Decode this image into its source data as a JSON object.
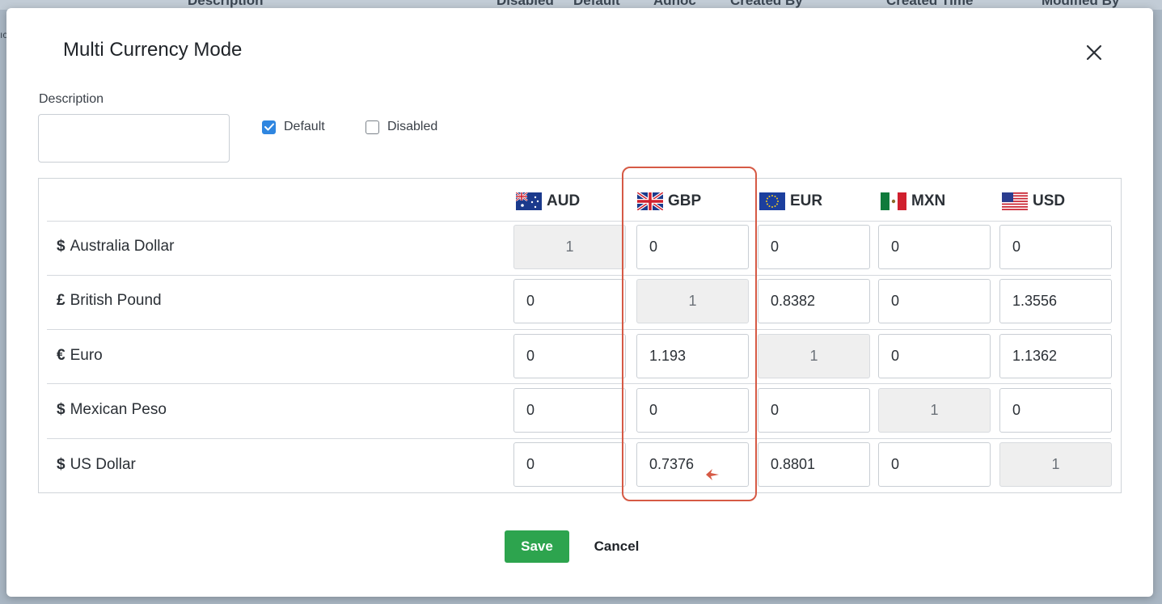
{
  "background_header": {
    "columns": [
      "Description",
      "Disabled",
      "Default",
      "Adhoc",
      "Created By",
      "Created Time",
      "Modified By"
    ],
    "edge_text": "ıc"
  },
  "modal": {
    "title": "Multi Currency Mode",
    "description_label": "Description",
    "description_value": "",
    "default_label": "Default",
    "default_checked": true,
    "disabled_label": "Disabled",
    "disabled_checked": false,
    "save_label": "Save",
    "cancel_label": "Cancel"
  },
  "currencies": [
    {
      "code": "AUD",
      "flag": "australia-flag-icon"
    },
    {
      "code": "GBP",
      "flag": "uk-flag-icon"
    },
    {
      "code": "EUR",
      "flag": "eu-flag-icon"
    },
    {
      "code": "MXN",
      "flag": "mexico-flag-icon"
    },
    {
      "code": "USD",
      "flag": "us-flag-icon"
    }
  ],
  "rows": [
    {
      "symbol": "$",
      "name": "Australia Dollar",
      "values": [
        "1",
        "0",
        "0",
        "0",
        "0"
      ]
    },
    {
      "symbol": "£",
      "name": "British Pound",
      "values": [
        "0",
        "1",
        "0.8382",
        "0",
        "1.3556"
      ]
    },
    {
      "symbol": "€",
      "name": "Euro",
      "values": [
        "0",
        "1.193",
        "1",
        "0",
        "1.1362"
      ]
    },
    {
      "symbol": "$",
      "name": "Mexican Peso",
      "values": [
        "0",
        "0",
        "0",
        "1",
        "0"
      ]
    },
    {
      "symbol": "$",
      "name": "US Dollar",
      "values": [
        "0",
        "0.7376",
        "0.8801",
        "0",
        "1"
      ]
    }
  ],
  "colors": {
    "highlight": "#d65a45",
    "save": "#2da44e",
    "checkbox": "#2f86e0"
  }
}
